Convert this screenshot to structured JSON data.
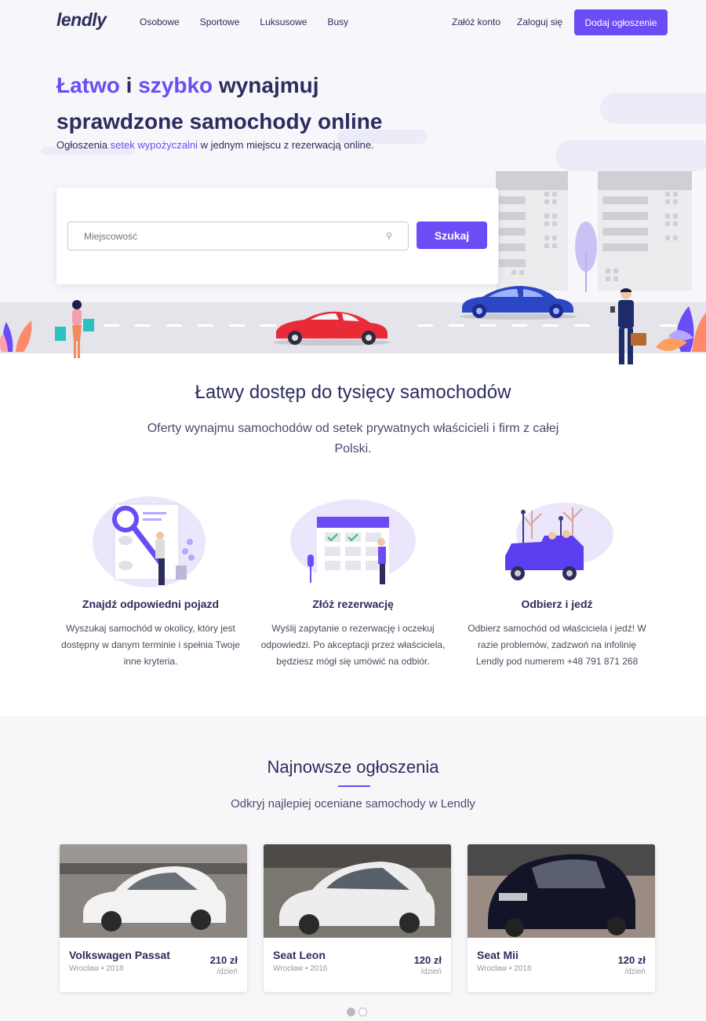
{
  "nav": {
    "logo": "lendly",
    "links": [
      "Osobowe",
      "Sportowe",
      "Luksusowe",
      "Busy"
    ],
    "register": "Załóż konto",
    "login": "Zaloguj się",
    "add_listing": "Dodaj ogłoszenie"
  },
  "hero": {
    "title_word1": "Łatwo",
    "title_conj": "i",
    "title_word2": "szybko",
    "title_rest1": "wynajmuj",
    "title_line2": "sprawdzone samochody online",
    "subtitle_pre": "Ogłoszenia",
    "subtitle_link": "setek wypożyczalni",
    "subtitle_post": "w jednym miejscu z rezerwacją online."
  },
  "search": {
    "placeholder": "Miejscowość",
    "button": "Szukaj"
  },
  "access": {
    "title": "Łatwy dostęp do tysięcy samochodów",
    "subtitle": "Oferty wynajmu samochodów od setek prywatnych właścicieli i firm z całej Polski."
  },
  "features": [
    {
      "title": "Znajdź odpowiedni pojazd",
      "text": "Wyszukaj samochód w okolicy, który jest dostępny w danym terminie i spełnia Twoje inne kryteria."
    },
    {
      "title": "Złóż rezerwację",
      "text": "Wyślij zapytanie o rezerwację i oczekuj odpowiedzi. Po akceptacji przez właściciela, będziesz mógł się umówić na odbiór."
    },
    {
      "title": "Odbierz i jedź",
      "text": "Odbierz samochód od właściciela i jedź! W razie problemów, zadzwoń na infolinię Lendly pod numerem +48 791 871 268"
    }
  ],
  "listings": {
    "title": "Najnowsze ogłoszenia",
    "subtitle": "Odkryj najlepiej oceniane samochody w Lendly",
    "cars": [
      {
        "name": "Volkswagen Passat",
        "meta": "Wrocław • 2018",
        "price": "210 zł",
        "unit": "/dzień"
      },
      {
        "name": "Seat Leon",
        "meta": "Wrocław • 2016",
        "price": "120 zł",
        "unit": "/dzień"
      },
      {
        "name": "Seat Mii",
        "meta": "Wrocław • 2018",
        "price": "120 zł",
        "unit": "/dzień"
      }
    ],
    "active_page": 1
  },
  "colors": {
    "accent": "#6c4cf5",
    "navy": "#2c2c5e"
  }
}
